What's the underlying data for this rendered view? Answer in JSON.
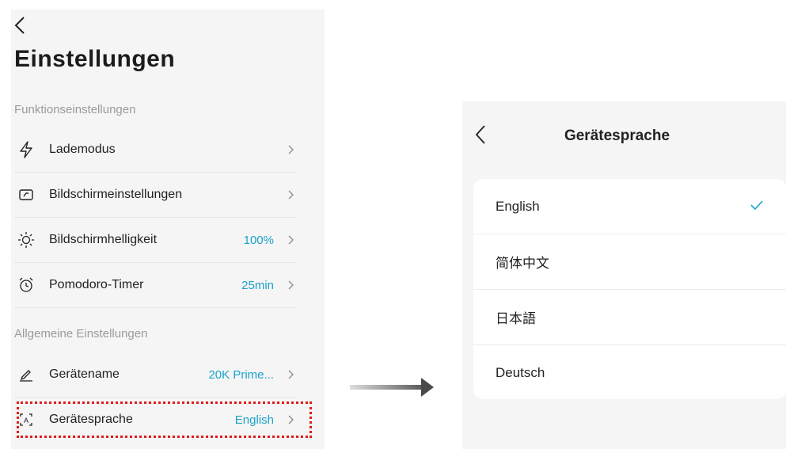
{
  "left": {
    "title": "Einstellungen",
    "sections": {
      "functions": "Funktionseinstellungen",
      "general": "Allgemeine Einstellungen"
    },
    "items": [
      {
        "icon": "lightning-icon",
        "label": "Lademodus",
        "value": ""
      },
      {
        "icon": "screen-icon",
        "label": "Bildschirmeinstellungen",
        "value": ""
      },
      {
        "icon": "brightness-icon",
        "label": "Bildschirmhelligkeit",
        "value": "100%"
      },
      {
        "icon": "alarm-clock-icon",
        "label": "Pomodoro-Timer",
        "value": "25min"
      },
      {
        "icon": "pencil-icon",
        "label": "Gerätename",
        "value": "20K Prime..."
      },
      {
        "icon": "language-icon",
        "label": "Gerätesprache",
        "value": "English"
      }
    ]
  },
  "right": {
    "title": "Gerätesprache",
    "languages": [
      {
        "label": "English",
        "selected": true
      },
      {
        "label": "简体中文",
        "selected": false
      },
      {
        "label": "日本語",
        "selected": false
      },
      {
        "label": "Deutsch",
        "selected": false
      }
    ]
  },
  "colors": {
    "accent": "#1aa3c9",
    "highlight": "#e21a1a",
    "panel": "#f5f5f5"
  }
}
